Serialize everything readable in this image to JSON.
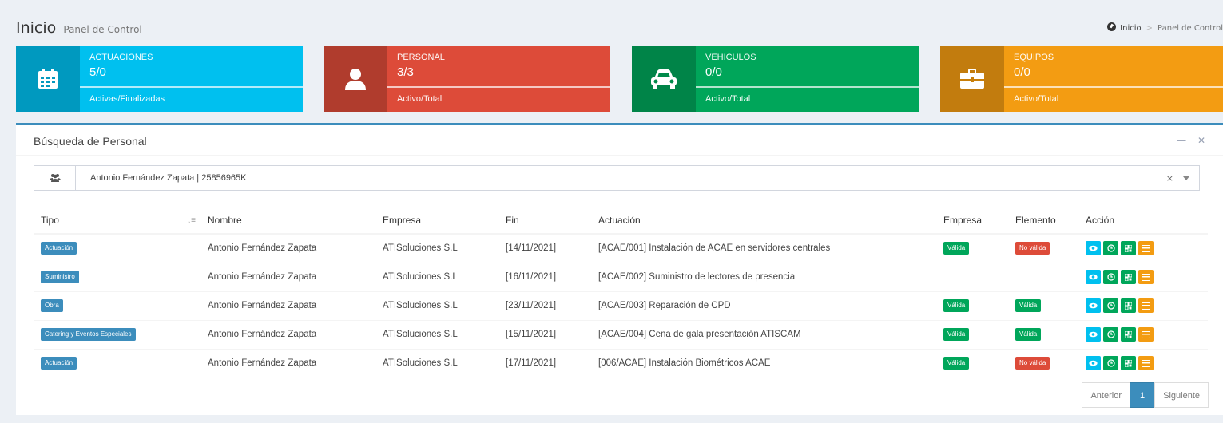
{
  "header": {
    "title": "Inicio",
    "subtitle": "Panel de Control",
    "breadcrumb": [
      "Inicio",
      "Panel de Control"
    ]
  },
  "info_boxes": [
    {
      "title": "ACTUACIONES",
      "number": "5/0",
      "desc": "Activas/Finalizadas",
      "color": "#00c0ef",
      "icon": "calendar-icon"
    },
    {
      "title": "PERSONAL",
      "number": "3/3",
      "desc": "Activo/Total",
      "color": "#dd4b39",
      "icon": "user-icon"
    },
    {
      "title": "VEHICULOS",
      "number": "0/0",
      "desc": "Activo/Total",
      "color": "#00a65a",
      "icon": "car-icon"
    },
    {
      "title": "EQUIPOS",
      "number": "0/0",
      "desc": "Activo/Total",
      "color": "#f39c12",
      "icon": "briefcase-icon"
    }
  ],
  "search_box": {
    "title": "Búsqueda de Personal",
    "selected": "Antonio Fernández Zapata | 25856965K",
    "clear": "×"
  },
  "table": {
    "headers": [
      "Tipo",
      "Nombre",
      "Empresa",
      "Fin",
      "Actuación",
      "Empresa",
      "Elemento",
      "Acción"
    ],
    "rows": [
      {
        "tipo": "Actuación",
        "nombre": "Antonio Fernández Zapata",
        "empresa": "ATISoluciones S.L",
        "fin": "[14/11/2021]",
        "actuacion": "[ACAE/001] Instalación de ACAE en servidores centrales",
        "estado_empresa": "Válida",
        "estado_elemento": "No válida"
      },
      {
        "tipo": "Suministro",
        "nombre": "Antonio Fernández Zapata",
        "empresa": "ATISoluciones S.L",
        "fin": "[16/11/2021]",
        "actuacion": "[ACAE/002] Suministro de lectores de presencia",
        "estado_empresa": "",
        "estado_elemento": ""
      },
      {
        "tipo": "Obra",
        "nombre": "Antonio Fernández Zapata",
        "empresa": "ATISoluciones S.L",
        "fin": "[23/11/2021]",
        "actuacion": "[ACAE/003] Reparación de CPD",
        "estado_empresa": "Válida",
        "estado_elemento": "Válida"
      },
      {
        "tipo": "Catering y Eventos Especiales",
        "nombre": "Antonio Fernández Zapata",
        "empresa": "ATISoluciones S.L",
        "fin": "[15/11/2021]",
        "actuacion": "[ACAE/004] Cena de gala presentación ATISCAM",
        "estado_empresa": "Válida",
        "estado_elemento": "Válida"
      },
      {
        "tipo": "Actuación",
        "nombre": "Antonio Fernández Zapata",
        "empresa": "ATISoluciones S.L",
        "fin": "[17/11/2021]",
        "actuacion": "[006/ACAE] Instalación Biométricos ACAE",
        "estado_empresa": "Válida",
        "estado_elemento": "No válida"
      }
    ]
  },
  "pagination": {
    "prev": "Anterior",
    "page": "1",
    "next": "Siguiente"
  },
  "colors": {
    "valid": "#00a65a",
    "invalid": "#dd4b39",
    "primary": "#3c8dbc"
  }
}
